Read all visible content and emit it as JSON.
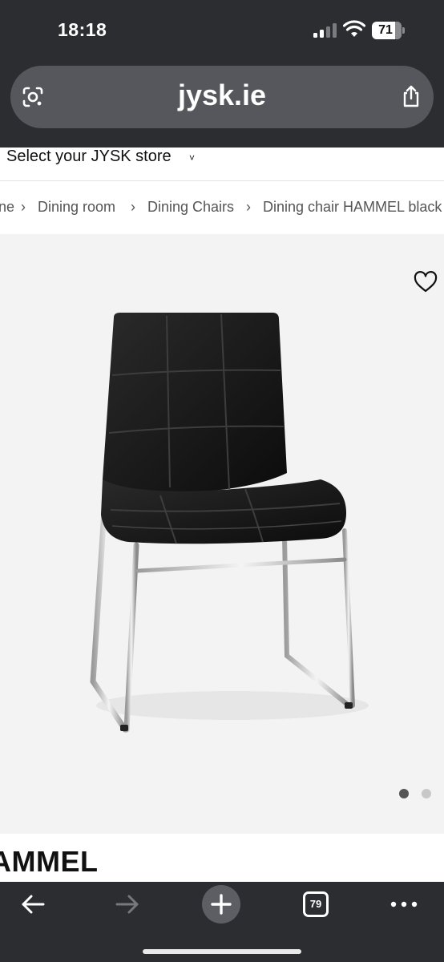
{
  "status_bar": {
    "time": "18:18",
    "battery_percent": "71"
  },
  "browser": {
    "url": "jysk.ie",
    "tab_count": "79",
    "icons": {
      "lens": "lens-icon",
      "share": "share-icon",
      "back": "back-arrow-icon",
      "forward": "forward-arrow-icon",
      "new_tab": "plus-icon",
      "tabs": "tabs-icon",
      "more": "more-icon"
    }
  },
  "store_selector": {
    "label": "Select your JYSK store",
    "chevron": "˅"
  },
  "breadcrumb": {
    "separator": "›",
    "items": [
      "ne",
      "Dining room",
      "Dining Chairs",
      "Dining chair HAMMEL black"
    ]
  },
  "product": {
    "title": "AMMEL",
    "image_name": "Dining chair HAMMEL black",
    "gallery": {
      "total_images": 2,
      "active_index": 0
    }
  },
  "colors": {
    "chrome_bg": "#2b2d31",
    "url_bar_bg": "#55575c",
    "image_bg": "#f3f3f3",
    "dot_active": "#555555",
    "dot_inactive": "#c8c8c8"
  }
}
